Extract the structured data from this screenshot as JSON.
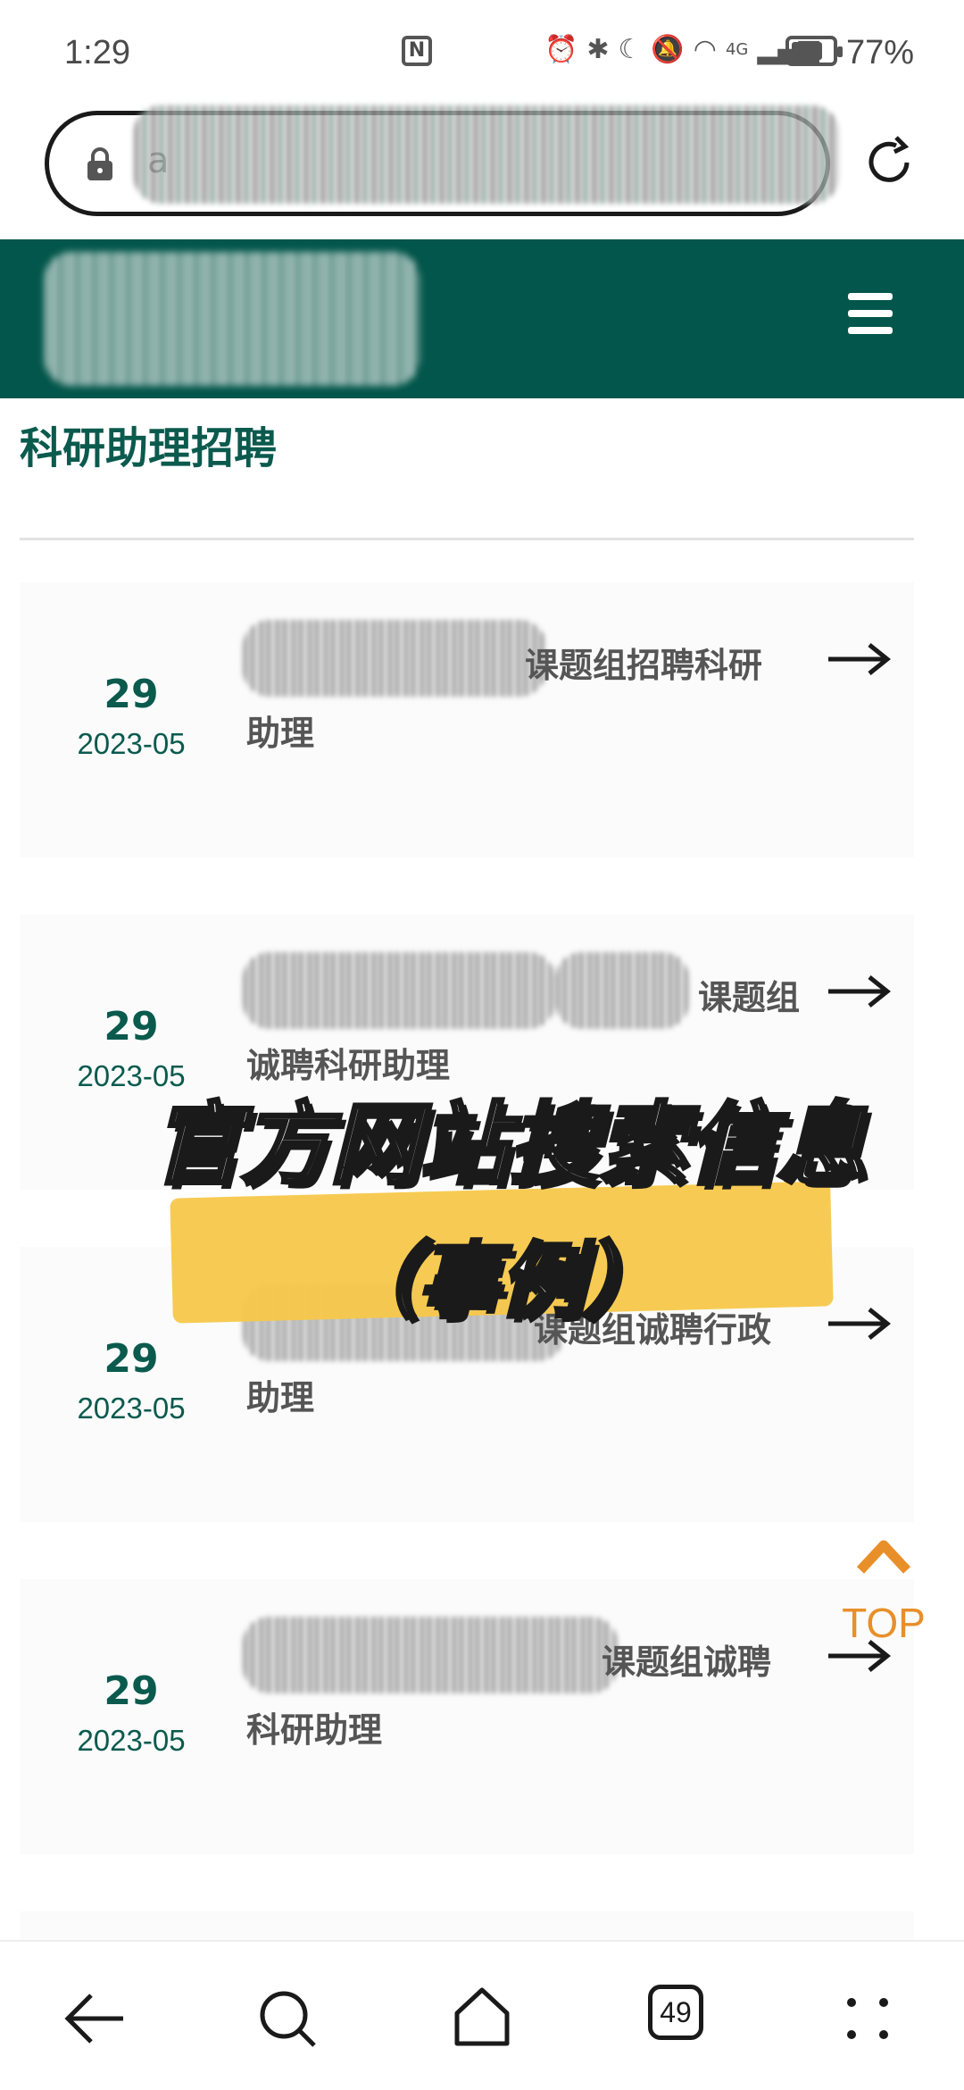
{
  "status_bar": {
    "time": "1:29",
    "nfc": "N",
    "battery_percent": "77%",
    "battery_level": 0.77,
    "network_label": "4G"
  },
  "browser": {
    "url_visible": "a",
    "tab_count": "49"
  },
  "page": {
    "section_title": "科研助理招聘",
    "items": [
      {
        "day": "29",
        "year_month": "2023-05",
        "title_line1": "课题组招聘科研",
        "title_line2": "助理"
      },
      {
        "day": "29",
        "year_month": "2023-05",
        "title_line1": "课题组",
        "title_line2": "诚聘科研助理"
      },
      {
        "day": "29",
        "year_month": "2023-05",
        "title_line1": "课题组诚聘行政",
        "title_line2": "助理"
      },
      {
        "day": "29",
        "year_month": "2023-05",
        "title_line1": "课题组诚聘",
        "title_line2": "科研助理"
      }
    ],
    "top_label": "TOP"
  },
  "overlay": {
    "line1": "官方网站搜索信息",
    "line2": "（事例）"
  },
  "colors": {
    "brand": "#03564b",
    "brand_text": "#0b5a4e",
    "accent_orange": "#e88f2a",
    "highlight_yellow": "#f7c84a"
  },
  "icons": [
    "lock-icon",
    "reload-icon",
    "menu-icon",
    "arrow-right-icon",
    "chevron-up-icon",
    "back-icon",
    "search-icon",
    "home-icon",
    "more-icon"
  ]
}
